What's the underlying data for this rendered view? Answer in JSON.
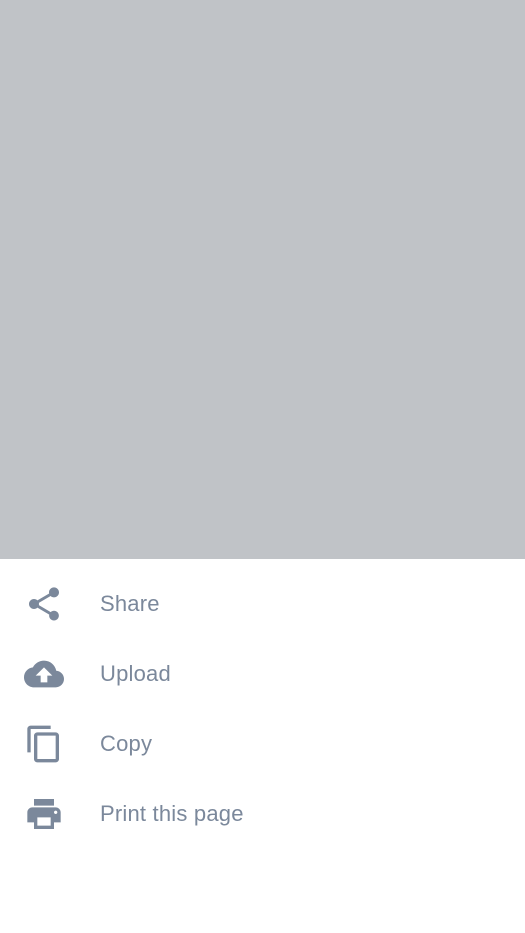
{
  "colors": {
    "scrim": "#c0c3c7",
    "sheet_background": "#ffffff",
    "icon": "#7b889b",
    "text": "#7b889b"
  },
  "sheet": {
    "items": [
      {
        "label": "Share",
        "icon": "share-icon"
      },
      {
        "label": "Upload",
        "icon": "cloud-upload-icon"
      },
      {
        "label": "Copy",
        "icon": "copy-icon"
      },
      {
        "label": "Print this page",
        "icon": "print-icon"
      }
    ]
  }
}
